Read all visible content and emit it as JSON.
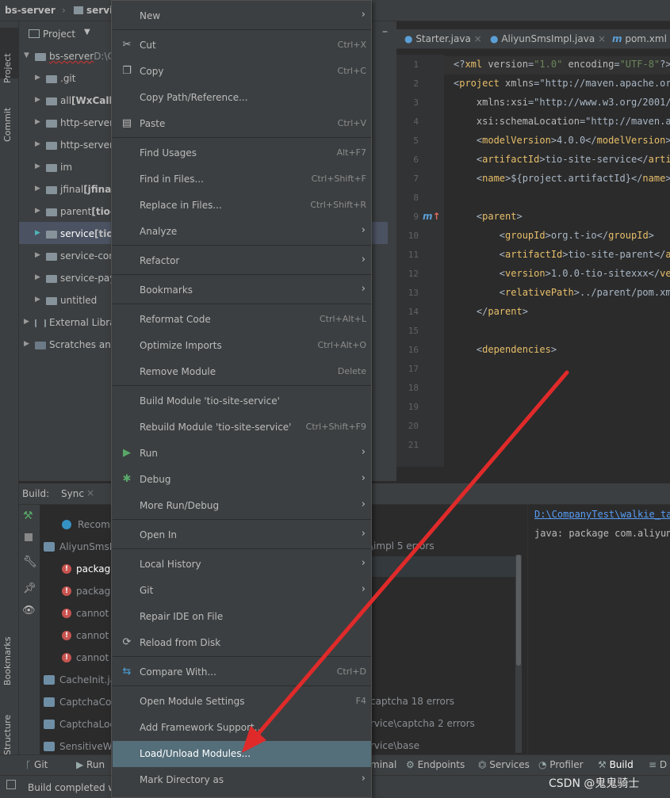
{
  "topbar": {
    "project": "bs-server",
    "module": "servic"
  },
  "left_strip": {
    "project_tab": "Project",
    "commit_tab": "Commit",
    "bookmarks_tab": "Bookmarks",
    "structure_tab": "Structure"
  },
  "project_panel": {
    "header": "Project",
    "tree": [
      {
        "label": "bs-server",
        "suffix": "D:\\C"
      },
      {
        "label": ".git"
      },
      {
        "label": "all",
        "suffix": "[WxCall1"
      },
      {
        "label": "http-server-"
      },
      {
        "label": "http-server-"
      },
      {
        "label": "im"
      },
      {
        "label": "jfinal",
        "suffix": "[jfinal"
      },
      {
        "label": "parent",
        "suffix": "[tio-"
      },
      {
        "label": "service",
        "suffix": "[tio-"
      },
      {
        "label": "service-com"
      },
      {
        "label": "service-pay"
      },
      {
        "label": "untitled"
      },
      {
        "label": "External Librari"
      },
      {
        "label": "Scratches and C"
      }
    ]
  },
  "editor": {
    "tabs": [
      "Starter.java",
      "AliyunSmsImpl.java",
      "pom.xml"
    ],
    "line_numbers": [
      "1",
      "2",
      "3",
      "4",
      "5",
      "6",
      "7",
      "8",
      "9",
      "10",
      "11",
      "12",
      "13",
      "14",
      "15",
      "16",
      "17",
      "18",
      "19",
      "20",
      "21"
    ],
    "lines": [
      "<?xml version=\"1.0\" encoding=\"UTF-8\"?>",
      "<project xmlns=\"http://maven.apache.org",
      "    xmlns:xsi=\"http://www.w3.org/2001/X",
      "    xsi:schemaLocation=\"http://maven.ap",
      "    <modelVersion>4.0.0</modelVersion>",
      "    <artifactId>tio-site-service</artif",
      "    <name>${project.artifactId}</name>",
      "",
      "    <parent>",
      "        <groupId>org.t-io</groupId>",
      "        <artifactId>tio-site-parent</ar",
      "        <version>1.0.0-tio-sitexxx</ver",
      "        <relativePath>../parent/pom.xml",
      "    </parent>",
      "",
      "    <dependencies>",
      "",
      "",
      "",
      "",
      ""
    ]
  },
  "build_panel": {
    "tab_build": "Build:",
    "tab_sync": "Sync",
    "rows": [
      {
        "label": "Recompi"
      },
      {
        "label": "AliyunSmsIn",
        "right": "\\impl 5 errors"
      },
      {
        "label": "package"
      },
      {
        "label": "package"
      },
      {
        "label": "cannot fi"
      },
      {
        "label": "cannot fi"
      },
      {
        "label": "cannot fi"
      },
      {
        "label": "CacheInit.jav"
      },
      {
        "label": "CaptchaCor",
        "right": "captcha 18 errors"
      },
      {
        "label": "CaptchaLoc",
        "right": "rvice\\captcha 2 errors"
      },
      {
        "label": "SensitiveWo",
        "right": "rvice\\base"
      }
    ],
    "output_path": "D:\\CompanyTest\\walkie_ta",
    "output_msg": "java: package com.aliyunc"
  },
  "bottom_tools": [
    "Git",
    "Run",
    "minal",
    "Endpoints",
    "Services",
    "Profiler",
    "Build",
    "D"
  ],
  "status": {
    "text": "Build completed wit"
  },
  "watermark": "CSDN @鬼鬼骑士",
  "context_menu": {
    "items": [
      {
        "label": "New",
        "shortcut": "",
        "submenu": true
      },
      {
        "label": "Cut",
        "shortcut": "Ctrl+X"
      },
      {
        "label": "Copy",
        "shortcut": "Ctrl+C"
      },
      {
        "label": "Copy Path/Reference...",
        "shortcut": ""
      },
      {
        "label": "Paste",
        "shortcut": "Ctrl+V"
      },
      {
        "label": "Find Usages",
        "shortcut": "Alt+F7"
      },
      {
        "label": "Find in Files...",
        "shortcut": "Ctrl+Shift+F"
      },
      {
        "label": "Replace in Files...",
        "shortcut": "Ctrl+Shift+R"
      },
      {
        "label": "Analyze",
        "submenu": true
      },
      {
        "label": "Refactor",
        "submenu": true
      },
      {
        "label": "Bookmarks",
        "submenu": true
      },
      {
        "label": "Reformat Code",
        "shortcut": "Ctrl+Alt+L"
      },
      {
        "label": "Optimize Imports",
        "shortcut": "Ctrl+Alt+O"
      },
      {
        "label": "Remove Module",
        "shortcut": "Delete"
      },
      {
        "label": "Build Module 'tio-site-service'",
        "shortcut": ""
      },
      {
        "label": "Rebuild Module 'tio-site-service'",
        "shortcut": "Ctrl+Shift+F9"
      },
      {
        "label": "Run",
        "submenu": true
      },
      {
        "label": "Debug",
        "submenu": true
      },
      {
        "label": "More Run/Debug",
        "submenu": true
      },
      {
        "label": "Open In",
        "submenu": true
      },
      {
        "label": "Local History",
        "submenu": true
      },
      {
        "label": "Git",
        "submenu": true
      },
      {
        "label": "Repair IDE on File",
        "shortcut": ""
      },
      {
        "label": "Reload from Disk",
        "shortcut": ""
      },
      {
        "label": "Compare With...",
        "shortcut": "Ctrl+D"
      },
      {
        "label": "Open Module Settings",
        "shortcut": "F4"
      },
      {
        "label": "Add Framework Support...",
        "shortcut": ""
      },
      {
        "label": "Load/Unload Modules...",
        "shortcut": ""
      },
      {
        "label": "Mark Directory as",
        "submenu": true
      }
    ],
    "highlight_color": "#546e7a",
    "arrow_color": "#e02a2a"
  }
}
